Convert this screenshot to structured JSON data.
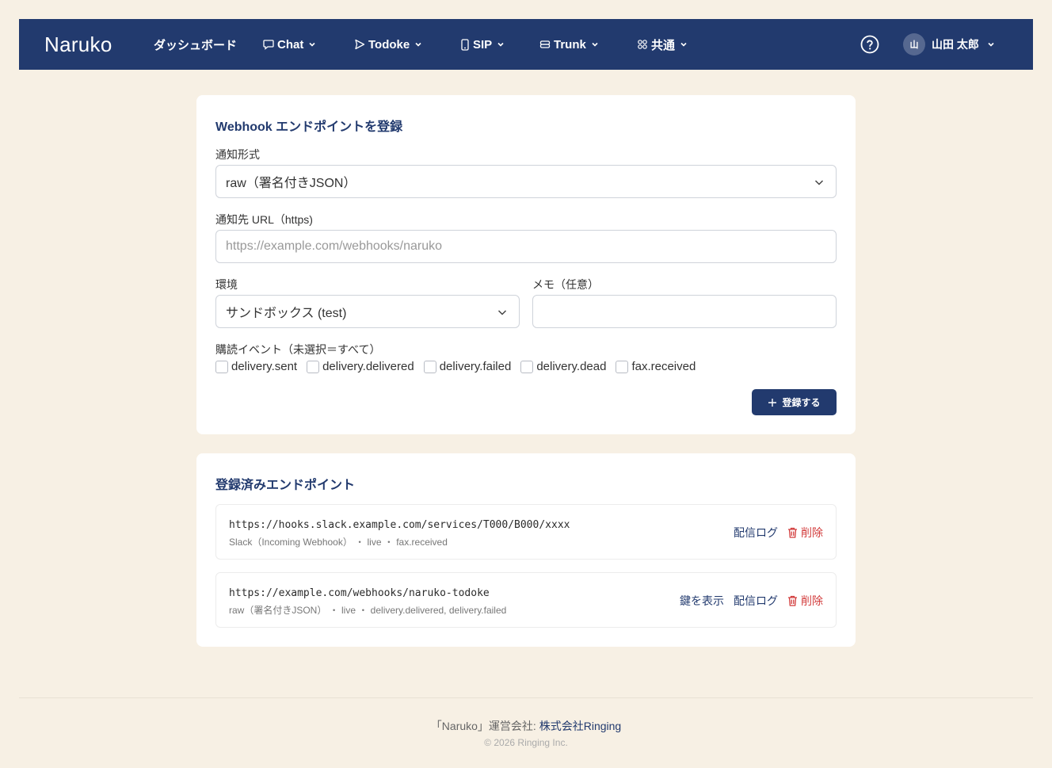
{
  "nav": {
    "brand": "Naruko",
    "items": [
      {
        "label": "ダッシュボード"
      },
      {
        "label": "Chat"
      },
      {
        "label": "Todoke"
      },
      {
        "label": "SIP"
      },
      {
        "label": "Trunk"
      },
      {
        "label": "共通"
      }
    ],
    "user": {
      "avatar": "山",
      "name": "山田 太郎"
    }
  },
  "register": {
    "title": "Webhook エンドポイントを登録",
    "format_label": "通知形式",
    "format_value": "raw（署名付きJSON）",
    "url_label": "通知先 URL（https)",
    "url_placeholder": "https://example.com/webhooks/naruko",
    "env_label": "環境",
    "env_value": "サンドボックス (test)",
    "memo_label": "メモ（任意）",
    "memo_value": "",
    "events_label": "購読イベント（未選択＝すべて）",
    "events": [
      {
        "label": "delivery.sent",
        "checked": false
      },
      {
        "label": "delivery.delivered",
        "checked": false
      },
      {
        "label": "delivery.failed",
        "checked": false
      },
      {
        "label": "delivery.dead",
        "checked": false
      },
      {
        "label": "fax.received",
        "checked": false
      }
    ],
    "submit_label": "登録する"
  },
  "registered": {
    "title": "登録済みエンドポイント",
    "endpoints": [
      {
        "url": "https://hooks.slack.example.com/services/T000/B000/xxxx",
        "meta": "Slack（Incoming Webhook） ・ live ・ fax.received",
        "log_label": "配信ログ",
        "delete_label": "削除"
      },
      {
        "url": "https://example.com/webhooks/naruko-todoke",
        "meta": "raw（署名付きJSON） ・ live ・ delivery.delivered, delivery.failed",
        "show_key_label": "鍵を表示",
        "log_label": "配信ログ",
        "delete_label": "削除"
      }
    ]
  },
  "footer": {
    "prefix": "「Naruko」運営会社: ",
    "company": "株式会社Ringing",
    "copyright": "© 2026 Ringing Inc."
  },
  "colors": {
    "nav": "#223a6e",
    "background": "#f7f0e4",
    "danger": "#d23b3b"
  }
}
